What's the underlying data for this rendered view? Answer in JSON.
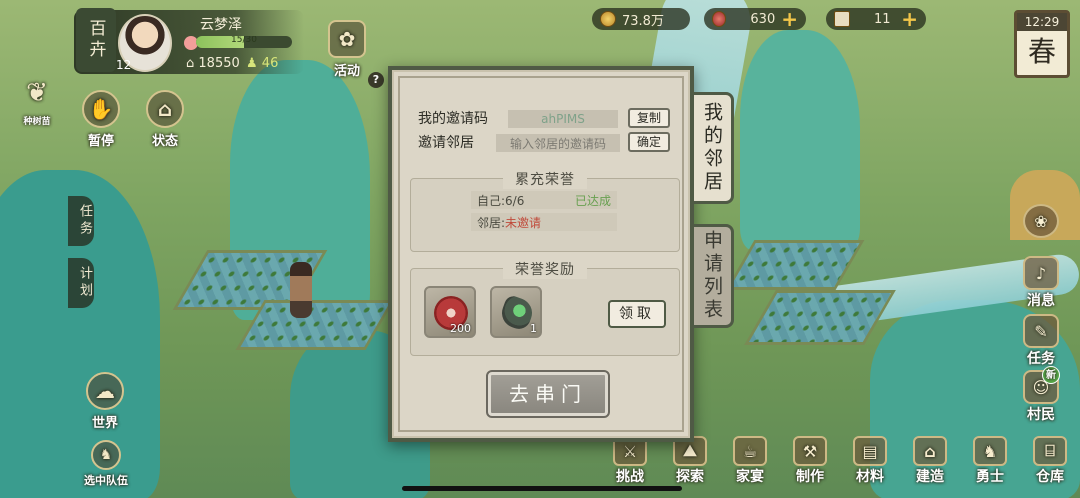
{
  "player": {
    "brand": "百卉",
    "name": "云梦泽",
    "level": "12",
    "xp_text": "15/30",
    "xp_fill": 0.5,
    "stat_a": "18550",
    "stat_b": "46"
  },
  "resources": {
    "coins": "73.8万",
    "gems": "630",
    "tickets": "11"
  },
  "clock": {
    "time": "12:29",
    "season": "春"
  },
  "left_buttons": {
    "activity": "活动",
    "pause": "暂停",
    "status": "状态",
    "plant_label": "种树苗",
    "task_tab": "任务",
    "plan_tab": "计划",
    "world": "世界",
    "team": "选中队伍"
  },
  "right_buttons": {
    "message": "消息",
    "task": "任务",
    "villager": "村民",
    "new_badge": "新"
  },
  "bottom_bar": [
    "挑战",
    "探索",
    "家宴",
    "制作",
    "材料",
    "建造",
    "勇士",
    "仓库"
  ],
  "dialog": {
    "my_code_label": "我的邀请码",
    "my_code_value": "ahPIMS",
    "copy_btn": "复制",
    "invite_label": "邀请邻居",
    "invite_placeholder": "输入邻居的邀请码",
    "confirm_btn": "确定",
    "honor_title": "累充荣誉",
    "self_label": "自己:6/6",
    "self_status": "已达成",
    "neighbor_label": "邻居:",
    "neighbor_status": "未邀请",
    "reward_title": "荣誉奖励",
    "reward_1_count": "200",
    "reward_2_count": "1",
    "claim_btn": "领取",
    "go_btn": "去串门",
    "help": "?"
  },
  "tabs": {
    "my_neighbor": "我的邻居",
    "apply_list": "申请列表"
  }
}
